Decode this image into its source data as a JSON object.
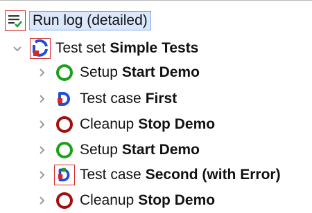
{
  "root": {
    "label": "Run log (detailed)",
    "icon": "list-check-icon"
  },
  "suite": {
    "prefix": "Test set",
    "name": "Simple Tests",
    "icon": "run-progress-icon"
  },
  "items": [
    {
      "prefix": "Setup",
      "name": "Start Demo",
      "icon": "setup-ok-icon",
      "color": "#1aa11a"
    },
    {
      "prefix": "Test case",
      "name": "First",
      "icon": "testcase-icon",
      "color": "#1e4fd8"
    },
    {
      "prefix": "Cleanup",
      "name": "Stop Demo",
      "icon": "cleanup-icon",
      "color": "#a30f0f"
    },
    {
      "prefix": "Setup",
      "name": "Start Demo",
      "icon": "setup-ok-icon",
      "color": "#1aa11a"
    },
    {
      "prefix": "Test case",
      "name": "Second (with Error)",
      "icon": "testcase-error-icon",
      "color": "#1e4fd8"
    },
    {
      "prefix": "Cleanup",
      "name": "Stop Demo",
      "icon": "cleanup-icon",
      "color": "#a30f0f"
    }
  ],
  "colors": {
    "accent_red": "#d62828",
    "selection_bg": "#dbe8fb",
    "selection_border": "#7aa7e6",
    "green": "#1aa11a",
    "blue": "#1e4fd8",
    "dark_red": "#a30f0f"
  }
}
